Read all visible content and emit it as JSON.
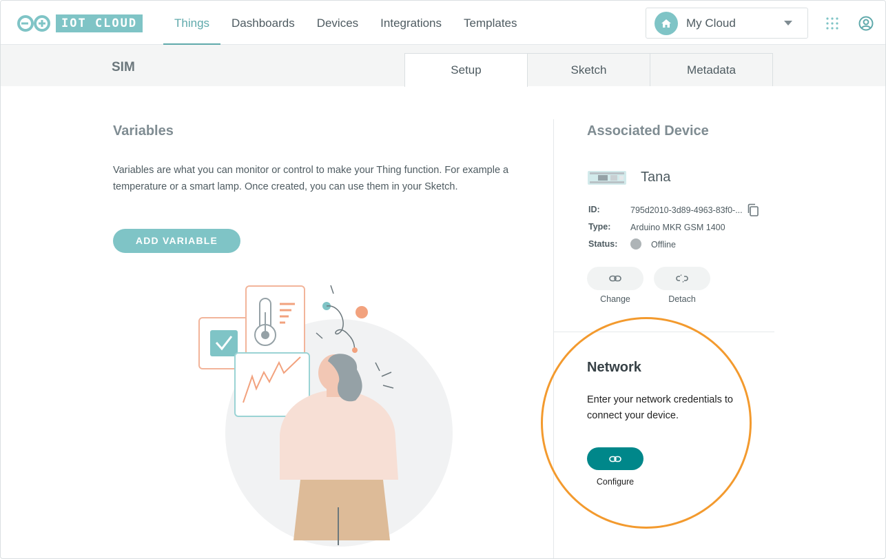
{
  "header": {
    "logo_text": "IOT CLOUD",
    "nav": [
      {
        "label": "Things",
        "active": true
      },
      {
        "label": "Dashboards",
        "active": false
      },
      {
        "label": "Devices",
        "active": false
      },
      {
        "label": "Integrations",
        "active": false
      },
      {
        "label": "Templates",
        "active": false
      }
    ],
    "space_selector": {
      "icon": "home-icon",
      "value": "My Cloud"
    },
    "icons": [
      "apps-grid-icon",
      "user-account-icon"
    ]
  },
  "thing": {
    "name": "SIM",
    "tabs": [
      {
        "label": "Setup",
        "active": true
      },
      {
        "label": "Sketch",
        "active": false
      },
      {
        "label": "Metadata",
        "active": false
      }
    ]
  },
  "variables": {
    "title": "Variables",
    "description": "Variables are what you can monitor or control to make your Thing function. For example a temperature or a smart lamp. Once created, you can use them in your Sketch.",
    "add_button": "ADD VARIABLE"
  },
  "device": {
    "title": "Associated Device",
    "name": "Tana",
    "id_label": "ID:",
    "id_value": "795d2010-3d89-4963-83f0-...",
    "type_label": "Type:",
    "type_value": "Arduino MKR GSM 1400",
    "status_label": "Status:",
    "status_value": "Offline",
    "change_label": "Change",
    "detach_label": "Detach"
  },
  "network": {
    "title": "Network",
    "description": "Enter your network credentials to connect your device.",
    "configure_label": "Configure"
  },
  "colors": {
    "accent": "#7fc4c6",
    "primary_dark": "#00878a",
    "highlight": "#f39a2e",
    "status_offline": "#aeb4b7"
  }
}
